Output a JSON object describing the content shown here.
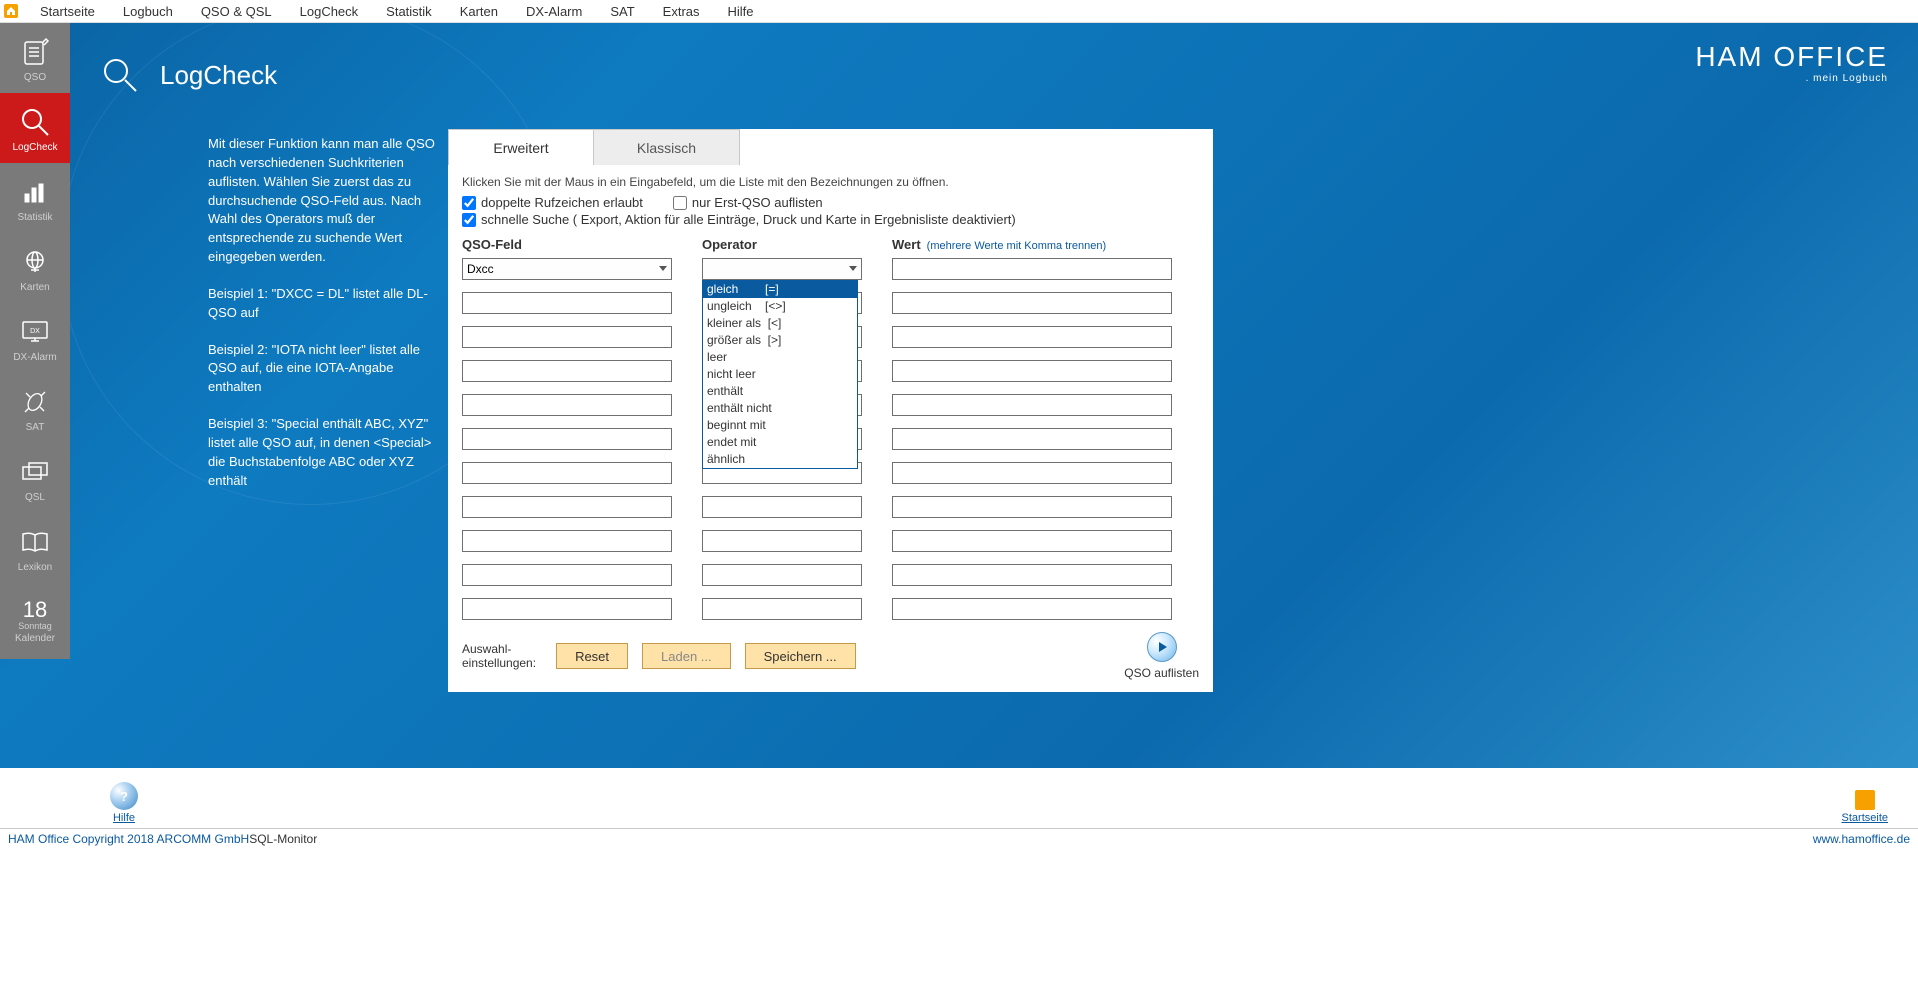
{
  "menubar": {
    "items": [
      "Startseite",
      "Logbuch",
      "QSO & QSL",
      "LogCheck",
      "Statistik",
      "Karten",
      "DX-Alarm",
      "SAT",
      "Extras",
      "Hilfe"
    ]
  },
  "sidebar": {
    "items": [
      {
        "label": "QSO"
      },
      {
        "label": "LogCheck"
      },
      {
        "label": "Statistik"
      },
      {
        "label": "Karten"
      },
      {
        "label": "DX-Alarm"
      },
      {
        "label": "SAT"
      },
      {
        "label": "QSL"
      },
      {
        "label": "Lexikon"
      }
    ],
    "calendar": {
      "day": "18",
      "weekday": "Sonntag",
      "label": "Kalender"
    }
  },
  "page": {
    "title": "LogCheck"
  },
  "brand": {
    "line1": "HAM OFFICE",
    "line2": ". mein Logbuch"
  },
  "desc": {
    "p0": "Mit dieser Funktion kann man alle QSO nach verschiedenen Suchkriterien auflisten. Wählen Sie zuerst das zu durchsuchende QSO-Feld aus. Nach Wahl des Operators muß der entsprechende zu suchende Wert eingegeben werden.",
    "p1": "Beispiel 1: \"DXCC   =   DL\"    listet alle DL-QSO auf",
    "p2": "Beispiel 2: \"IOTA   nicht leer\"   listet alle QSO auf, die eine IOTA-Angabe enthalten",
    "p3": "Beispiel 3: \"Special enthält ABC, XYZ\" listet alle QSO auf, in denen <Special> die Buchstabenfolge ABC oder XYZ enthält"
  },
  "panel": {
    "tabs": {
      "t0": "Erweitert",
      "t1": "Klassisch"
    },
    "hint": "Klicken Sie mit der Maus in ein Eingabefeld, um die Liste mit den Bezeichnungen zu öffnen.",
    "chk1": "doppelte Rufzeichen erlaubt",
    "chk2": "nur Erst-QSO auflisten",
    "chk3": "schnelle Suche ( Export, Aktion für alle Einträge, Druck und Karte in Ergebnisliste deaktiviert)",
    "headers": {
      "c0": "QSO-Feld",
      "c1": "Operator",
      "c2": "Wert",
      "c2sub": "(mehrere Werte mit Komma trennen)"
    },
    "qsoFieldValue": "Dxcc",
    "operatorOptions": [
      "gleich        [=]",
      "ungleich    [<>]",
      "kleiner als  [<]",
      "größer als  [>]",
      "leer",
      "nicht leer",
      "enthält",
      "enthält nicht",
      "beginnt mit",
      "endet mit",
      "ähnlich"
    ],
    "footer": {
      "label": "Auswahl-\neinstellungen:",
      "btnReset": "Reset",
      "btnLoad": "Laden ...",
      "btnSave": "Speichern ...",
      "btnList": "QSO auflisten"
    }
  },
  "helprow": {
    "help": "Hilfe",
    "start": "Startseite"
  },
  "status": {
    "left": "HAM Office Copyright 2018 ARCOMM GmbH",
    "mid": "SQL-Monitor",
    "right": "www.hamoffice.de"
  }
}
